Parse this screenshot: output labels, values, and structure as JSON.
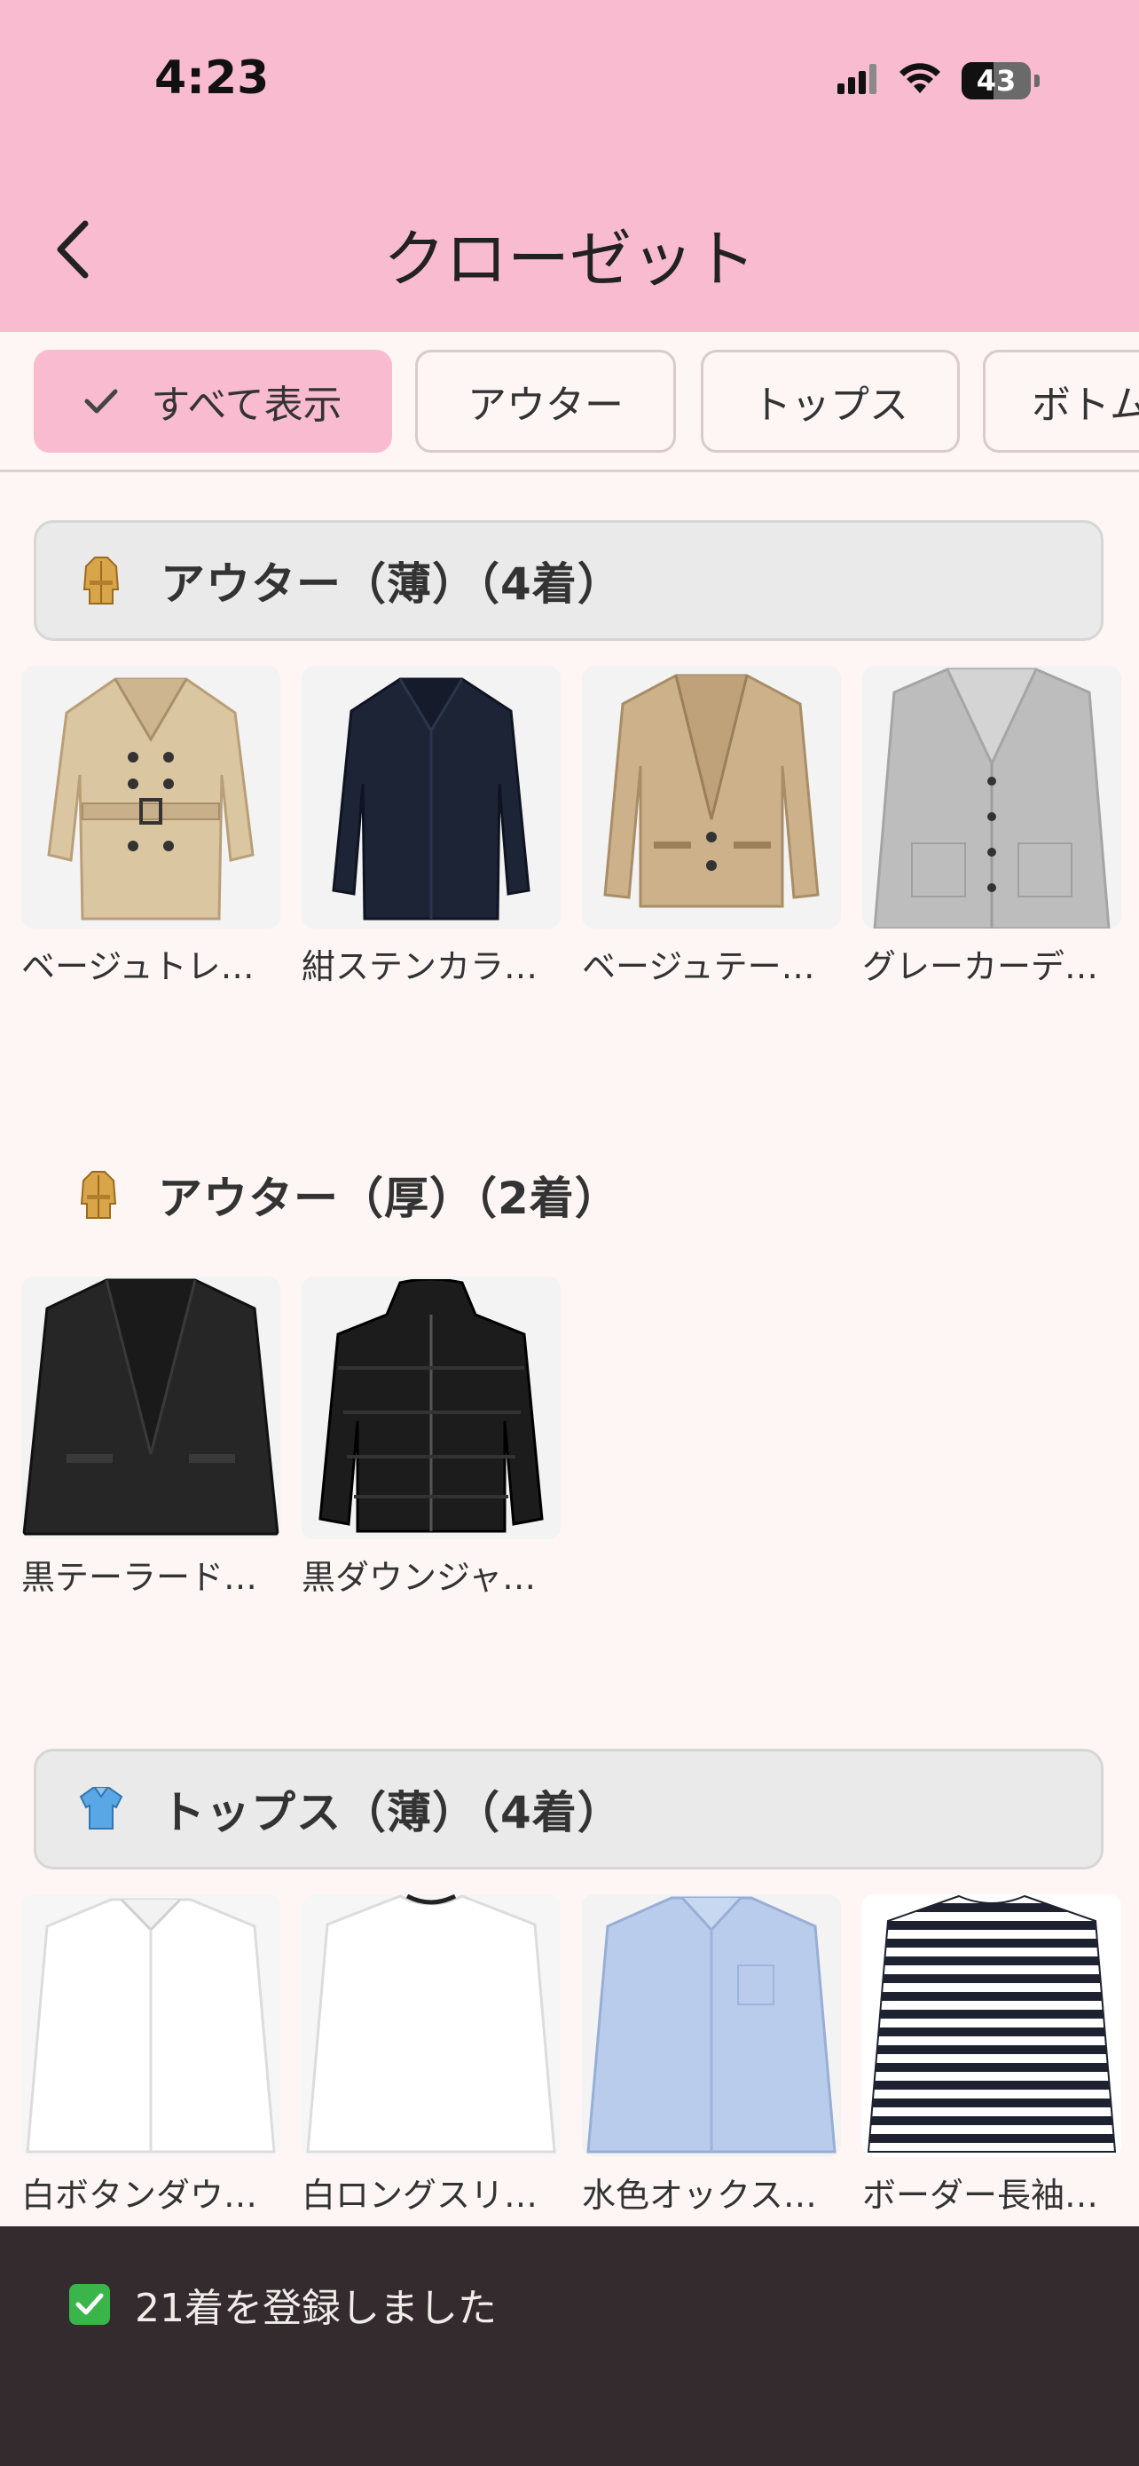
{
  "status_bar": {
    "time": "4:23",
    "battery": "43"
  },
  "header": {
    "title": "クローゼット"
  },
  "filters": [
    {
      "label": "すべて表示",
      "active": true
    },
    {
      "label": "アウター",
      "active": false
    },
    {
      "label": "トップス",
      "active": false
    },
    {
      "label": "ボトムス",
      "active": false
    }
  ],
  "sections": [
    {
      "title": "アウター（薄）（4着）",
      "icon": "trench-coat-icon",
      "items": [
        {
          "name": "ベージュトレ…",
          "image": "beige-trench-coat"
        },
        {
          "name": "紺ステンカラ…",
          "image": "navy-balmacaan-coat"
        },
        {
          "name": "ベージュテー…",
          "image": "beige-tailored-jacket"
        },
        {
          "name": "グレーカーデ…",
          "image": "gray-cardigan"
        }
      ]
    },
    {
      "title": "アウター（厚）（2着）",
      "icon": "trench-coat-icon",
      "items": [
        {
          "name": "黒テーラード…",
          "image": "black-tailored-jacket"
        },
        {
          "name": "黒ダウンジャ…",
          "image": "black-down-jacket"
        }
      ]
    },
    {
      "title": "トップス（薄）（4着）",
      "icon": "shirt-icon",
      "items": [
        {
          "name": "白ボタンダウ…",
          "image": "white-button-down-shirt"
        },
        {
          "name": "白ロングスリ…",
          "image": "white-long-sleeve-tee"
        },
        {
          "name": "水色オックス…",
          "image": "light-blue-oxford-shirt"
        },
        {
          "name": "ボーダー長袖…",
          "image": "striped-long-sleeve"
        }
      ]
    }
  ],
  "toast": {
    "text": "21着を登録しました",
    "icon": "check-mark-icon"
  },
  "colors": {
    "header_bg": "#f9bbd0",
    "page_bg": "#fdf6f5",
    "toast_bg": "#342b2f"
  }
}
